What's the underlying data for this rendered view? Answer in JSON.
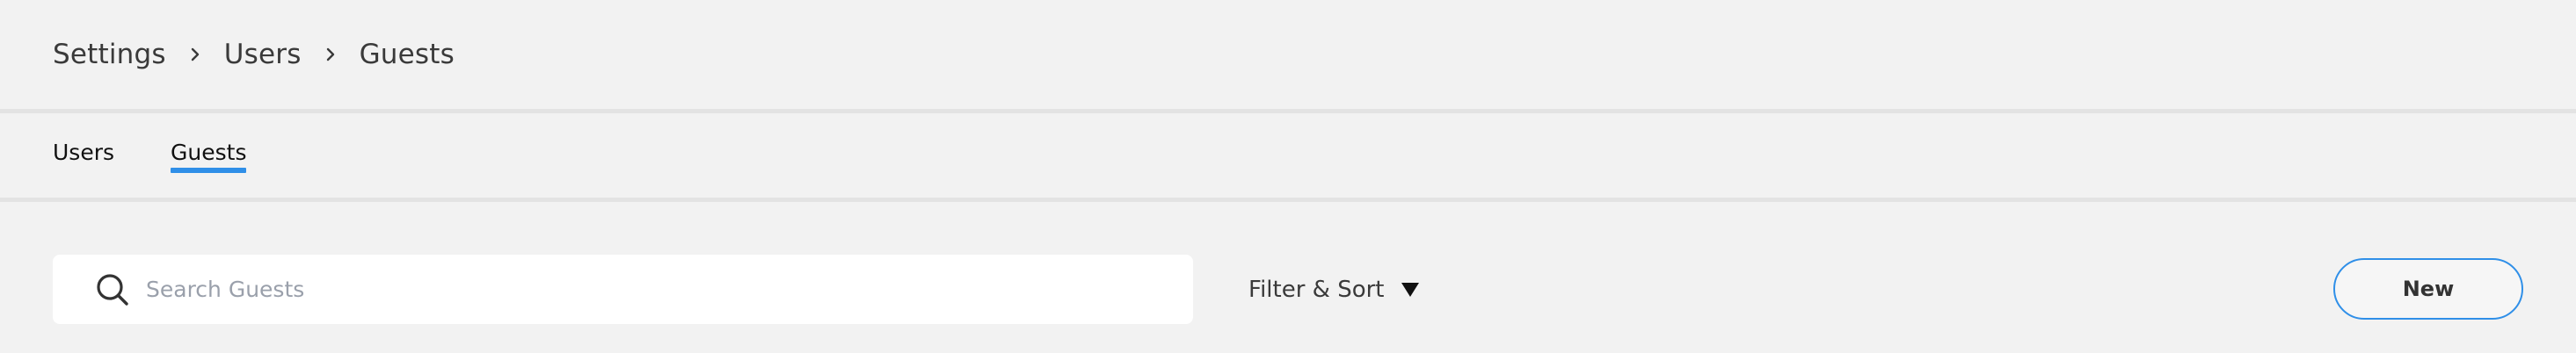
{
  "breadcrumb": {
    "items": [
      "Settings",
      "Users",
      "Guests"
    ],
    "separator_icon": "chevron-right-icon"
  },
  "tabs": [
    {
      "label": "Users",
      "active": false
    },
    {
      "label": "Guests",
      "active": true
    }
  ],
  "toolbar": {
    "search": {
      "placeholder": "Search Guests",
      "value": "",
      "icon": "search-icon"
    },
    "filter_sort": {
      "label": "Filter & Sort",
      "icon": "caret-down-icon"
    },
    "new_button_label": "New"
  },
  "colors": {
    "background": "#f2f2f2",
    "accent": "#2f8fe8",
    "divider": "#e3e3e3",
    "text": "#333333",
    "placeholder": "#9aa0ab"
  }
}
